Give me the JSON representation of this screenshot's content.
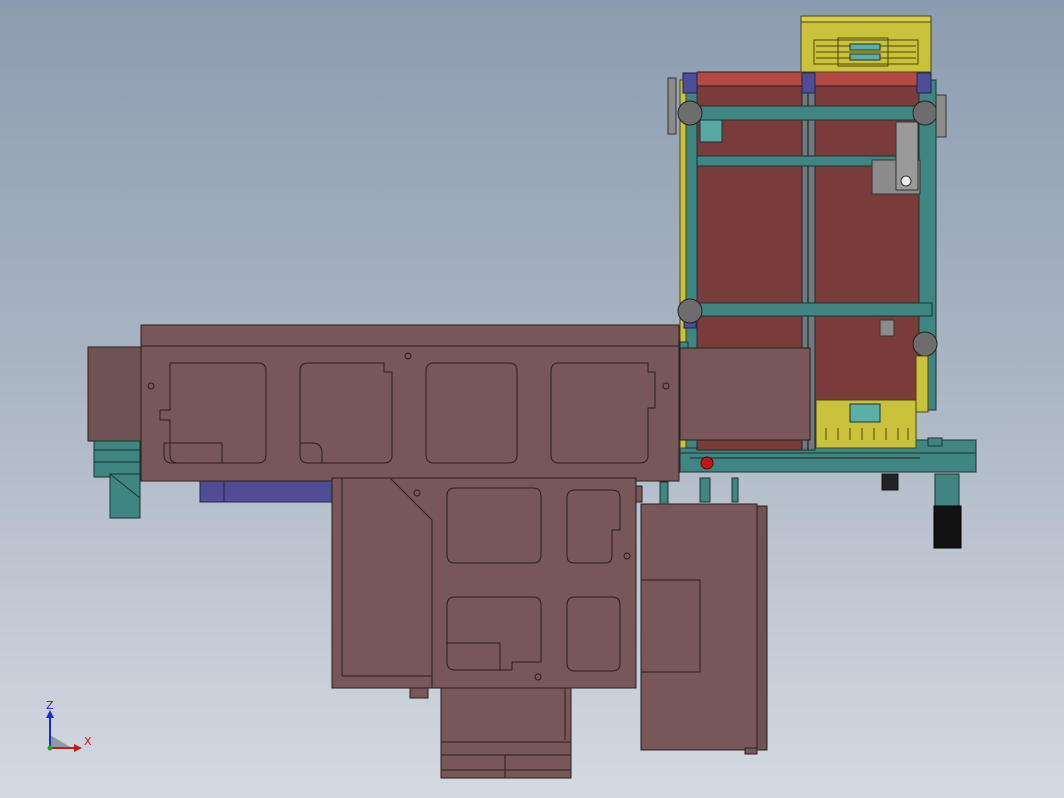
{
  "triad": {
    "z_label": "Z",
    "x_label": "X",
    "colors": {
      "z": "#1a2cc8",
      "x": "#c81818",
      "y": "#1aa81a"
    }
  },
  "palette": {
    "housing": "#775757",
    "belt": "#7a3c3a",
    "frame": "#3c8a88",
    "bracket": "#c9c23a",
    "motor": "#4f4d96",
    "roller": "#6d6d6d",
    "outline": "#2a1e1e"
  }
}
